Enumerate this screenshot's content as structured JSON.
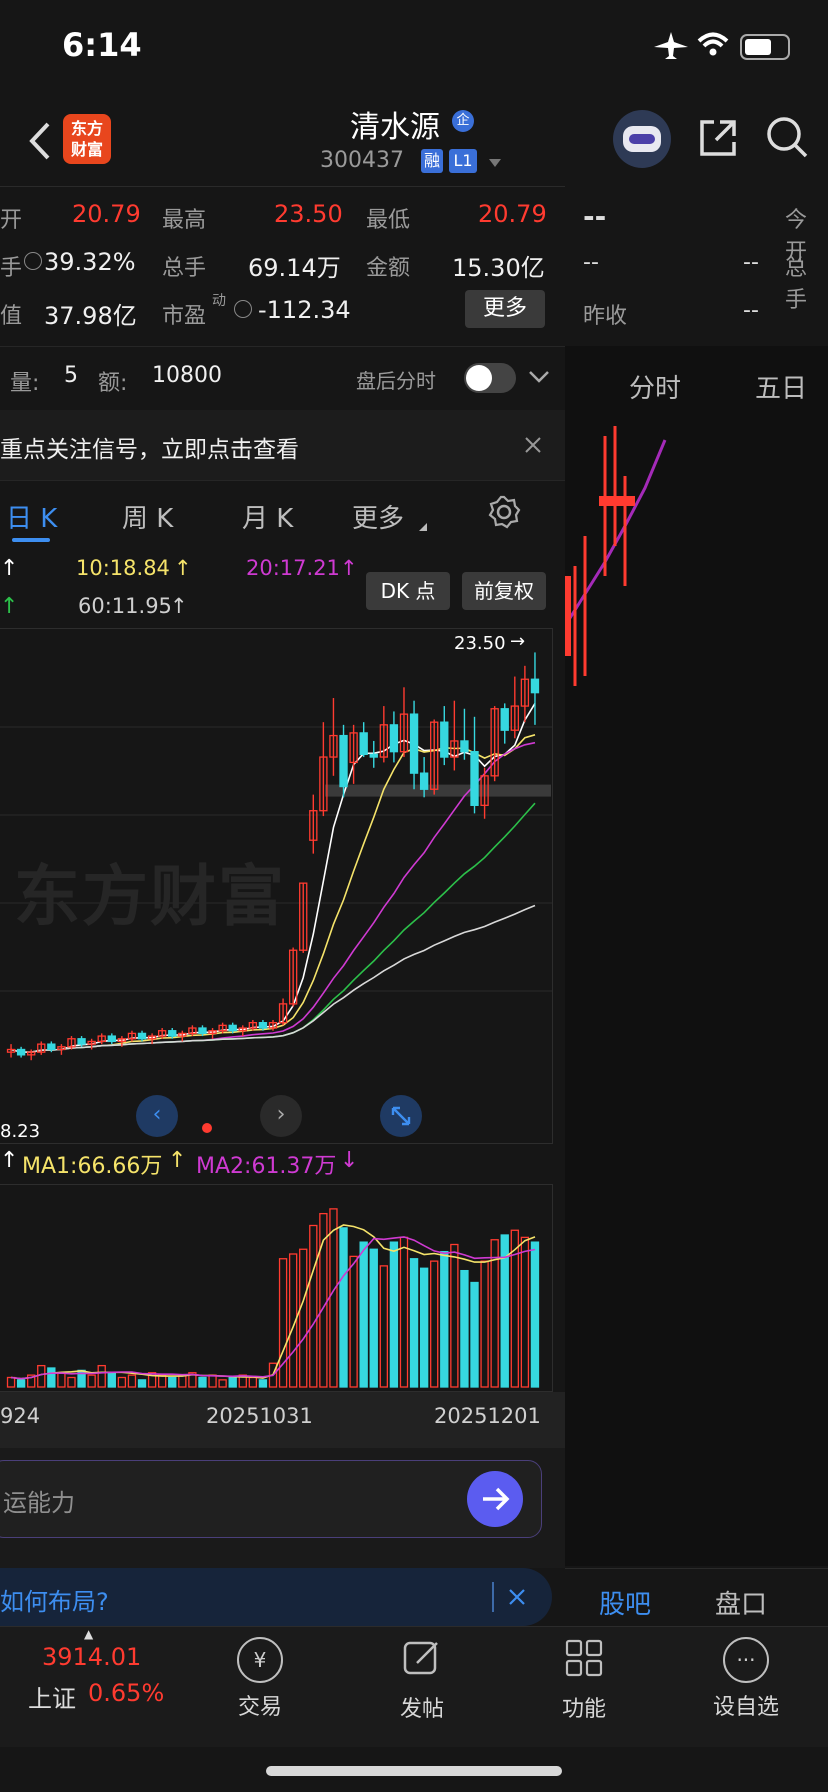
{
  "status_bar": {
    "time": "6:14"
  },
  "header": {
    "back_icon": "chevron-left-icon",
    "logo_text_1": "东方",
    "logo_text_2": "财富",
    "stock_name": "清水源",
    "name_badge": "企",
    "stock_code": "300437",
    "code_badge_1": "融",
    "code_badge_2": "L1"
  },
  "stats": {
    "row1": [
      {
        "label": "开",
        "value": "20.79"
      },
      {
        "label": "最高",
        "value": "23.50"
      },
      {
        "label": "最低",
        "value": "20.79"
      }
    ],
    "row2": [
      {
        "label": "手",
        "value": "39.32%"
      },
      {
        "label": "总手",
        "value": "69.14万"
      },
      {
        "label": "金额",
        "value": "15.30亿"
      }
    ],
    "row3": [
      {
        "label": "值",
        "value": "37.98亿"
      },
      {
        "label": "市盈",
        "value": "-112.34"
      }
    ],
    "more_button": "更多",
    "pe_superscript": "动",
    "volume_label": "量:",
    "volume_value": "5",
    "amount_label": "额:",
    "amount_value": "10800",
    "after_hours_label": "盘后分时"
  },
  "notice": {
    "text": "重点关注信号，立即点击查看"
  },
  "kline_tabs": {
    "day": "日 K",
    "week": "周 K",
    "month": "月 K",
    "more": "更多"
  },
  "ma_info": {
    "ma10": "10:18.84",
    "ma20": "20:17.21",
    "ma60": "60:11.95",
    "dk_button": "DK 点",
    "fq_button": "前复权",
    "high_label": "23.50",
    "low_label": "8.23",
    "watermark": "东方财富"
  },
  "volume_info": {
    "ma1": "MA1:66.66万",
    "ma2": "MA2:61.37万"
  },
  "date_axis": {
    "d1": "924",
    "d2": "20251031",
    "d3": "20251201"
  },
  "ai_input": {
    "placeholder": "运能力"
  },
  "banner": {
    "text": "如何布局?"
  },
  "right_panel": {
    "top_value": "--",
    "today_open_label": "今开",
    "total_label": "总手",
    "dash1": "--",
    "dash2": "--",
    "yclose_label": "昨收",
    "dash3": "--",
    "tab_fenshi": "分时",
    "tab_wuri": "五日",
    "tab_guba": "股吧",
    "tab_pankou": "盘口"
  },
  "bottom_nav": {
    "index_value": "3914.01",
    "index_name": "上证",
    "index_change": "0.65%",
    "trade": "交易",
    "post": "发帖",
    "func": "功能",
    "watch": "设自选"
  },
  "chart_data": {
    "type": "candlestick",
    "x_ticks": [
      "924",
      "20251031",
      "20251201"
    ],
    "price_high": 23.5,
    "price_low": 8.23,
    "candles": [
      [
        8.6,
        8.9,
        8.4,
        8.7
      ],
      [
        8.7,
        8.8,
        8.4,
        8.5
      ],
      [
        8.5,
        8.7,
        8.3,
        8.6
      ],
      [
        8.6,
        9.0,
        8.5,
        8.9
      ],
      [
        8.9,
        9.0,
        8.6,
        8.7
      ],
      [
        8.7,
        8.9,
        8.5,
        8.8
      ],
      [
        8.8,
        9.2,
        8.7,
        9.1
      ],
      [
        9.1,
        9.2,
        8.8,
        8.9
      ],
      [
        8.9,
        9.1,
        8.7,
        9.0
      ],
      [
        9.0,
        9.3,
        8.9,
        9.2
      ],
      [
        9.2,
        9.3,
        8.9,
        9.0
      ],
      [
        9.0,
        9.2,
        8.8,
        9.1
      ],
      [
        9.1,
        9.4,
        9.0,
        9.3
      ],
      [
        9.3,
        9.4,
        9.0,
        9.1
      ],
      [
        9.1,
        9.3,
        8.9,
        9.2
      ],
      [
        9.2,
        9.5,
        9.1,
        9.4
      ],
      [
        9.4,
        9.5,
        9.1,
        9.2
      ],
      [
        9.2,
        9.4,
        9.0,
        9.3
      ],
      [
        9.3,
        9.6,
        9.2,
        9.5
      ],
      [
        9.5,
        9.6,
        9.2,
        9.3
      ],
      [
        9.3,
        9.5,
        9.1,
        9.4
      ],
      [
        9.4,
        9.7,
        9.3,
        9.6
      ],
      [
        9.6,
        9.7,
        9.3,
        9.4
      ],
      [
        9.4,
        9.6,
        9.2,
        9.5
      ],
      [
        9.5,
        9.8,
        9.4,
        9.7
      ],
      [
        9.7,
        9.8,
        9.4,
        9.5
      ],
      [
        9.5,
        9.8,
        9.4,
        9.7
      ],
      [
        9.7,
        10.6,
        9.6,
        10.4
      ],
      [
        10.4,
        12.5,
        10.3,
        12.4
      ],
      [
        12.4,
        14.9,
        12.3,
        14.9
      ],
      [
        16.5,
        18.2,
        16.0,
        17.6
      ],
      [
        17.6,
        20.9,
        17.4,
        19.6
      ],
      [
        19.6,
        21.8,
        18.9,
        20.4
      ],
      [
        20.4,
        20.8,
        18.1,
        18.5
      ],
      [
        19.4,
        20.8,
        18.6,
        20.5
      ],
      [
        20.5,
        20.9,
        19.6,
        19.7
      ],
      [
        19.7,
        20.2,
        19.2,
        19.6
      ],
      [
        19.6,
        21.5,
        19.4,
        20.8
      ],
      [
        20.8,
        21.3,
        19.4,
        19.8
      ],
      [
        19.8,
        22.2,
        19.6,
        21.2
      ],
      [
        21.2,
        21.7,
        18.4,
        19.0
      ],
      [
        19.0,
        19.6,
        18.1,
        18.4
      ],
      [
        18.4,
        21.0,
        18.2,
        20.9
      ],
      [
        20.9,
        21.5,
        19.3,
        19.6
      ],
      [
        19.6,
        21.7,
        19.1,
        20.2
      ],
      [
        20.2,
        21.4,
        19.5,
        19.8
      ],
      [
        19.8,
        21.1,
        17.5,
        17.8
      ],
      [
        17.8,
        19.2,
        17.3,
        18.9
      ],
      [
        18.9,
        21.5,
        18.7,
        21.4
      ],
      [
        21.4,
        21.6,
        20.1,
        20.6
      ],
      [
        20.6,
        22.6,
        20.3,
        21.5
      ],
      [
        21.5,
        23.0,
        20.9,
        22.5
      ],
      [
        22.5,
        23.5,
        20.8,
        22.0
      ]
    ],
    "volume": [
      0.4,
      0.3,
      0.5,
      0.9,
      0.8,
      0.6,
      0.4,
      0.7,
      0.5,
      0.9,
      0.6,
      0.4,
      0.5,
      0.3,
      0.6,
      0.5,
      0.4,
      0.5,
      0.6,
      0.4,
      0.5,
      0.3,
      0.4,
      0.5,
      0.4,
      0.3,
      1.0,
      5.4,
      5.6,
      5.8,
      6.8,
      7.3,
      7.5,
      6.7,
      5.5,
      6.1,
      5.8,
      5.1,
      6.1,
      6.3,
      5.4,
      5.0,
      5.3,
      5.7,
      6.0,
      4.9,
      4.4,
      5.3,
      6.2,
      6.4,
      6.6,
      6.3,
      6.1
    ]
  }
}
